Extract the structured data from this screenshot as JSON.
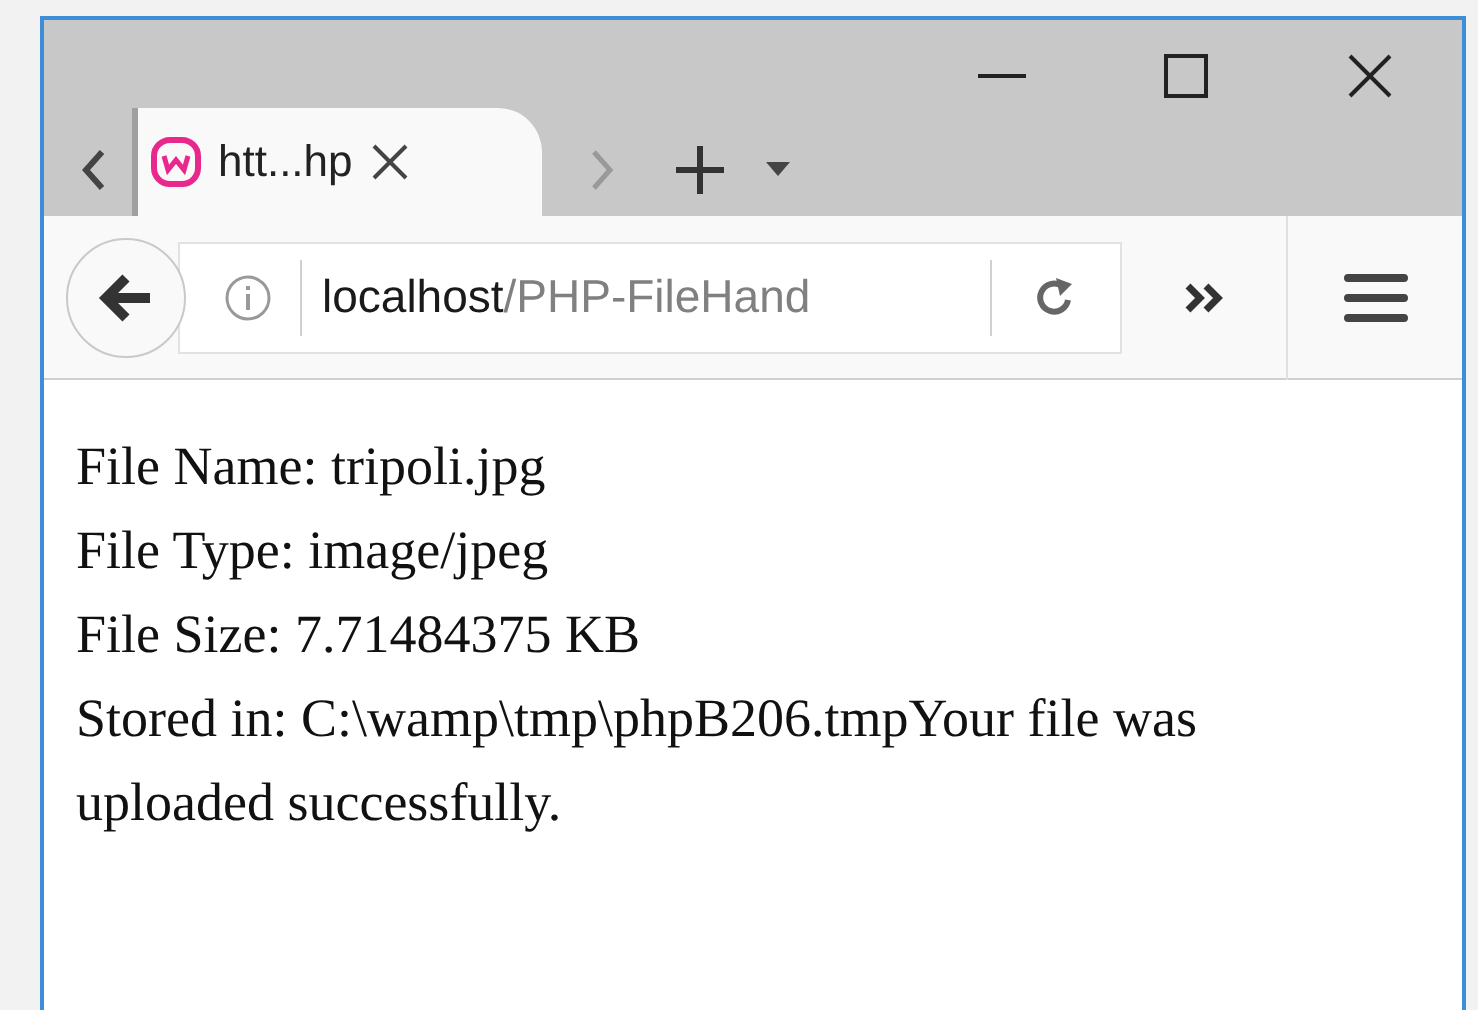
{
  "tab": {
    "title": "htt...hp",
    "selected": true
  },
  "address_bar": {
    "host": "localhost",
    "path": "/PHP-FileHand"
  },
  "content": {
    "lines": [
      "File Name: tripoli.jpg",
      "File Type: image/jpeg",
      "File Size: 7.71484375 KB",
      "Stored in: C:\\wamp\\tmp\\phpB206.tmpYour file was uploaded successfully."
    ]
  }
}
